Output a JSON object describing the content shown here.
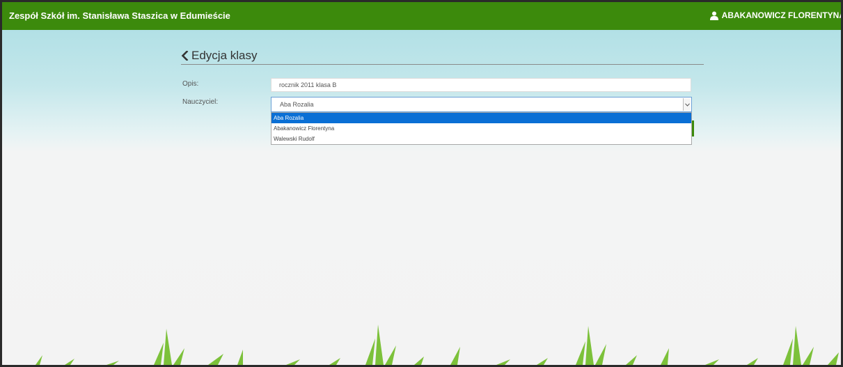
{
  "header": {
    "school_name": "Zespół Szkół im. Stanisława Staszica w Edumieście",
    "user_name": "ABAKANOWICZ FLORENTYNA",
    "user_icon": "user-icon"
  },
  "page": {
    "title": "Edycja klasy",
    "back_icon": "chevron-left-icon"
  },
  "form": {
    "opis_label": "Opis:",
    "opis_value": "rocznik 2011 klasa B",
    "nauczyciel_label": "Nauczyciel:",
    "nauczyciel_value": "Aba Rozalia",
    "nauczyciel_options": [
      "Aba Rozalia",
      "Abakanowicz Florentyna",
      "Walewski Rudolf"
    ],
    "selected_index": 0
  },
  "colors": {
    "header_green": "#3c8a0c",
    "selected_blue": "#0a6fd5"
  }
}
